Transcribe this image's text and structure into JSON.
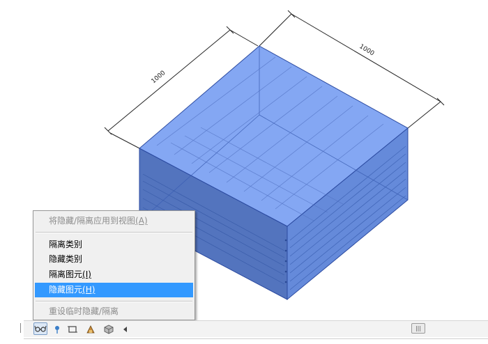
{
  "model": {
    "dimension_left": "1000",
    "dimension_right": "1000",
    "colors": {
      "top_face": "#7a9ff2",
      "left_face": "#4a6dba",
      "right_face": "#5d84d8",
      "edge": "#2b4aa0"
    }
  },
  "context_menu": {
    "apply_label": "将隐藏/隔离应用到视图",
    "apply_shortcut": "(A)",
    "isolate_category": "隔离类别",
    "hide_category": "隐藏类别",
    "isolate_element_label": "隔离图元",
    "isolate_element_shortcut": "(I)",
    "hide_element_label": "隐藏图元",
    "hide_element_shortcut": "(H)",
    "reset_label": "重设临时隐藏/隔离",
    "colors": {
      "selected_bg": "#3399ff"
    }
  },
  "status_bar": {
    "icons": [
      "glasses-icon",
      "pin-icon",
      "crop-icon",
      "render-icon",
      "cube-icon",
      "arrow-left-icon",
      "scroll-handle-icon"
    ]
  }
}
